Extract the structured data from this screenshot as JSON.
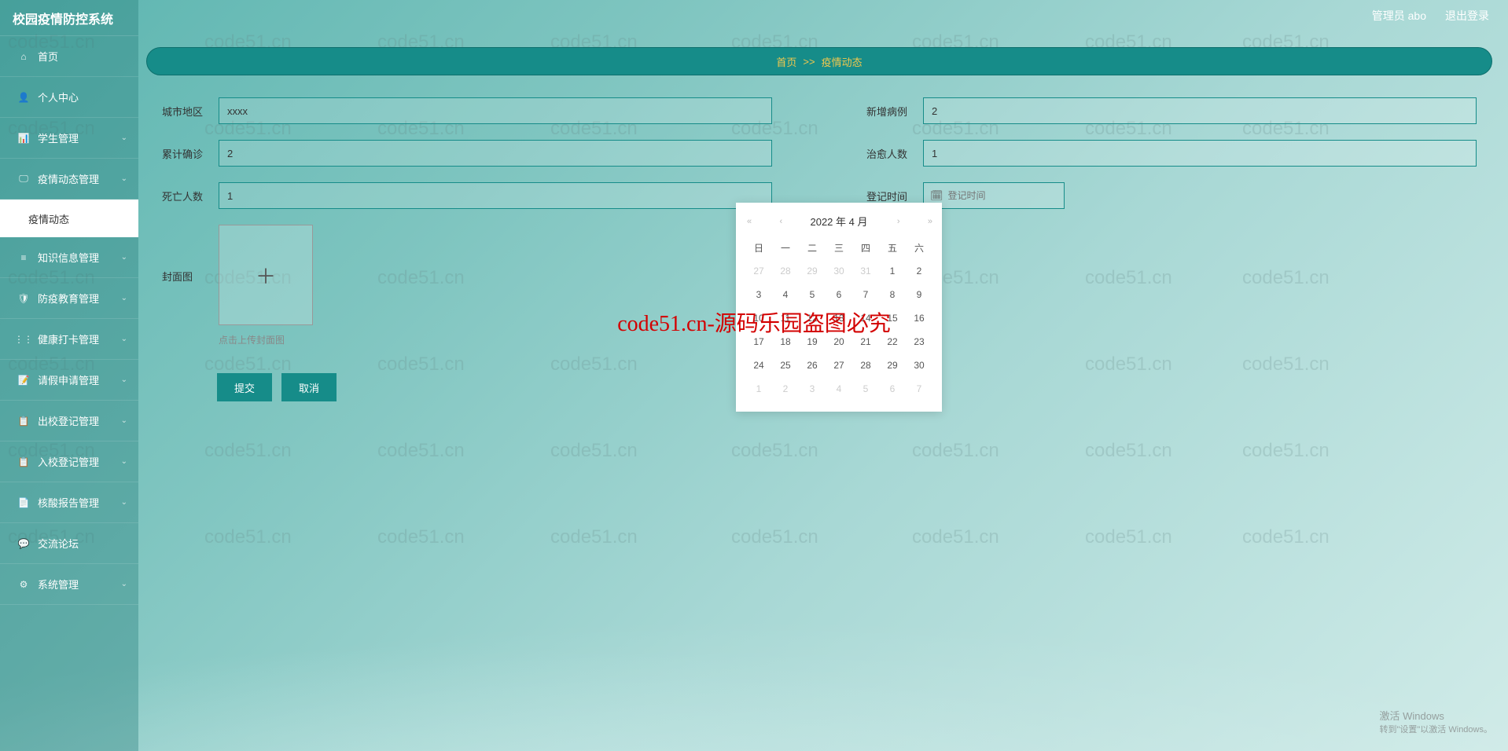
{
  "header": {
    "user_label": "管理员 abo",
    "logout_label": "退出登录"
  },
  "sidebar": {
    "title": "校园疫情防控系统",
    "items": [
      {
        "label": "首页",
        "icon": "home"
      },
      {
        "label": "个人中心",
        "icon": "user"
      },
      {
        "label": "学生管理",
        "icon": "chart",
        "expandable": true
      },
      {
        "label": "疫情动态管理",
        "icon": "monitor",
        "expandable": true
      },
      {
        "label": "知识信息管理",
        "icon": "list",
        "expandable": true
      },
      {
        "label": "防疫教育管理",
        "icon": "shield",
        "expandable": true
      },
      {
        "label": "健康打卡管理",
        "icon": "dots",
        "expandable": true
      },
      {
        "label": "请假申请管理",
        "icon": "form",
        "expandable": true
      },
      {
        "label": "出校登记管理",
        "icon": "log",
        "expandable": true
      },
      {
        "label": "入校登记管理",
        "icon": "log",
        "expandable": true
      },
      {
        "label": "核酸报告管理",
        "icon": "report",
        "expandable": true
      },
      {
        "label": "交流论坛",
        "icon": "chat"
      },
      {
        "label": "系统管理",
        "icon": "gear",
        "expandable": true
      }
    ],
    "active_sub": "疫情动态"
  },
  "breadcrumb": {
    "home": "首页",
    "sep": ">>",
    "current": "疫情动态"
  },
  "form": {
    "city_label": "城市地区",
    "city_value": "xxxx",
    "newcase_label": "新增病例",
    "newcase_value": "2",
    "total_label": "累计确诊",
    "total_value": "2",
    "cured_label": "治愈人数",
    "cured_value": "1",
    "death_label": "死亡人数",
    "death_value": "1",
    "regtime_label": "登记时间",
    "regtime_placeholder": "登记时间",
    "cover_label": "封面图",
    "upload_hint": "点击上传封面图",
    "submit": "提交",
    "cancel": "取消"
  },
  "datepicker": {
    "title": "2022 年 4 月",
    "weekdays": [
      "日",
      "一",
      "二",
      "三",
      "四",
      "五",
      "六"
    ],
    "rows": [
      [
        {
          "d": "27",
          "o": true
        },
        {
          "d": "28",
          "o": true
        },
        {
          "d": "29",
          "o": true
        },
        {
          "d": "30",
          "o": true
        },
        {
          "d": "31",
          "o": true
        },
        {
          "d": "1"
        },
        {
          "d": "2"
        }
      ],
      [
        {
          "d": "3"
        },
        {
          "d": "4"
        },
        {
          "d": "5"
        },
        {
          "d": "6"
        },
        {
          "d": "7"
        },
        {
          "d": "8"
        },
        {
          "d": "9"
        }
      ],
      [
        {
          "d": "10"
        },
        {
          "d": "11"
        },
        {
          "d": "12"
        },
        {
          "d": "13"
        },
        {
          "d": "14"
        },
        {
          "d": "15"
        },
        {
          "d": "16"
        }
      ],
      [
        {
          "d": "17"
        },
        {
          "d": "18"
        },
        {
          "d": "19"
        },
        {
          "d": "20"
        },
        {
          "d": "21"
        },
        {
          "d": "22"
        },
        {
          "d": "23"
        }
      ],
      [
        {
          "d": "24"
        },
        {
          "d": "25"
        },
        {
          "d": "26"
        },
        {
          "d": "27"
        },
        {
          "d": "28"
        },
        {
          "d": "29"
        },
        {
          "d": "30"
        }
      ],
      [
        {
          "d": "1",
          "o": true
        },
        {
          "d": "2",
          "o": true
        },
        {
          "d": "3",
          "o": true
        },
        {
          "d": "4",
          "o": true
        },
        {
          "d": "5",
          "o": true
        },
        {
          "d": "6",
          "o": true
        },
        {
          "d": "7",
          "o": true
        }
      ]
    ]
  },
  "watermark": {
    "main": "code51.cn-源码乐园盗图必究",
    "small": "code51.cn"
  },
  "activate": {
    "line1": "激活 Windows",
    "line2": "转到\"设置\"以激活 Windows。"
  }
}
